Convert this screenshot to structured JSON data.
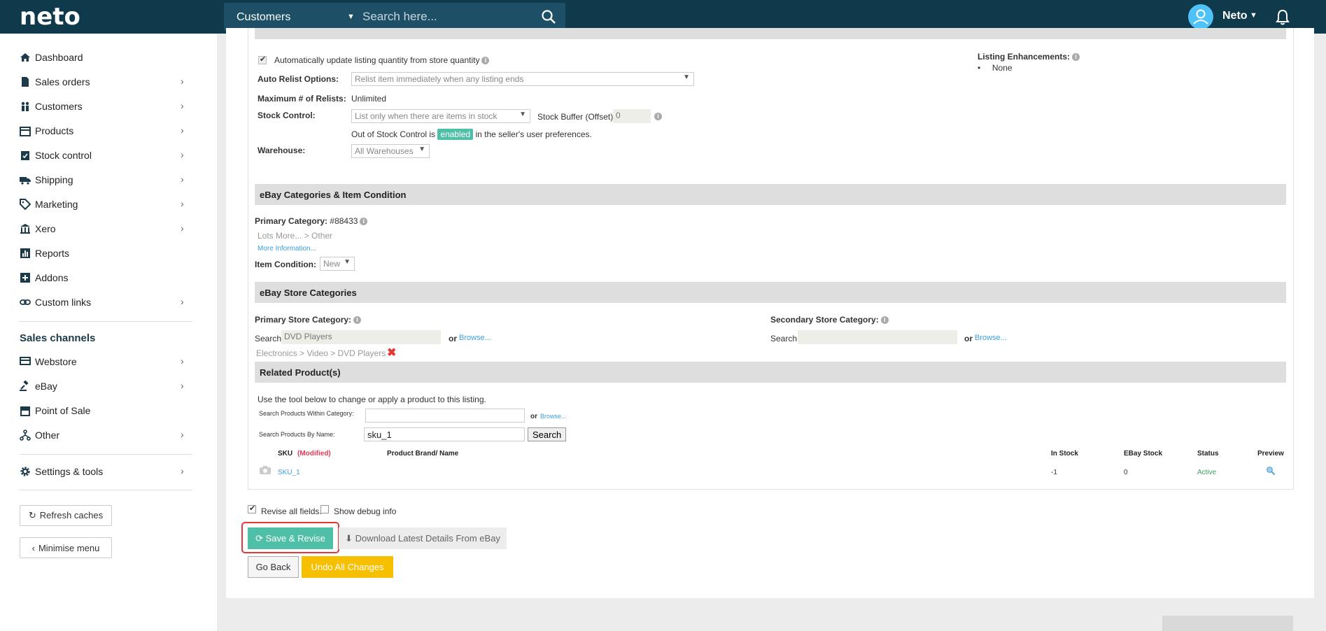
{
  "topbar": {
    "logo": "neto",
    "search_scope": "Customers",
    "search_placeholder": "Search here...",
    "username": "Neto"
  },
  "sidebar": {
    "items": [
      {
        "label": "Dashboard",
        "icon": "home-icon",
        "chevron": false
      },
      {
        "label": "Sales orders",
        "icon": "document-icon",
        "chevron": true
      },
      {
        "label": "Customers",
        "icon": "people-icon",
        "chevron": true
      },
      {
        "label": "Products",
        "icon": "box-icon",
        "chevron": true
      },
      {
        "label": "Stock control",
        "icon": "clipboard-icon",
        "chevron": true
      },
      {
        "label": "Shipping",
        "icon": "truck-icon",
        "chevron": true
      },
      {
        "label": "Marketing",
        "icon": "tag-icon",
        "chevron": true
      },
      {
        "label": "Xero",
        "icon": "bank-icon",
        "chevron": true
      },
      {
        "label": "Reports",
        "icon": "chart-icon",
        "chevron": false
      },
      {
        "label": "Addons",
        "icon": "plus-icon",
        "chevron": false
      },
      {
        "label": "Custom links",
        "icon": "link-icon",
        "chevron": true
      }
    ],
    "channels_heading": "Sales channels",
    "channels": [
      {
        "label": "Webstore",
        "icon": "monitor-icon",
        "chevron": true
      },
      {
        "label": "eBay",
        "icon": "gavel-icon",
        "chevron": true
      },
      {
        "label": "Point of Sale",
        "icon": "store-icon",
        "chevron": false
      },
      {
        "label": "Other",
        "icon": "fork-icon",
        "chevron": true
      }
    ],
    "settings": {
      "label": "Settings & tools",
      "icon": "gear-icon",
      "chevron": true
    },
    "refresh_label": "Refresh caches",
    "minimise_label": "Minimise menu"
  },
  "listing": {
    "auto_update_label": "Automatically update listing quantity from store quantity",
    "enhancements_label": "Listing Enhancements:",
    "enhancements_value": "None",
    "auto_relist_label": "Auto Relist Options:",
    "auto_relist_value": "Relist item immediately when any listing ends",
    "max_relists_label": "Maximum # of Relists:",
    "max_relists_value": "Unlimited",
    "stock_control_label": "Stock Control:",
    "stock_control_value": "List only when there are items in stock",
    "stock_buffer_label": "Stock Buffer (Offset)",
    "stock_buffer_value": "0",
    "oos_prefix": "Out of Stock Control is",
    "oos_badge": "enabled",
    "oos_suffix": "in the seller's user preferences.",
    "warehouse_label": "Warehouse:",
    "warehouse_value": "All Warehouses"
  },
  "categories": {
    "heading": "eBay Categories & Item Condition",
    "primary_label": "Primary Category:",
    "primary_value": "#88433",
    "path": "Lots More... > Other",
    "more_info": "More Information...",
    "condition_label": "Item Condition:",
    "condition_value": "New"
  },
  "store_categories": {
    "heading": "eBay Store Categories",
    "primary_label": "Primary Store Category:",
    "secondary_label": "Secondary Store Category:",
    "search_label": "Search",
    "primary_search_value": "DVD Players",
    "secondary_search_value": "",
    "or_label": "or",
    "browse_link": "Browse...",
    "primary_path": "Electronics > Video > DVD Players"
  },
  "related": {
    "heading": "Related Product(s)",
    "intro": "Use the tool below to change or apply a product to this listing.",
    "within_category_label": "Search Products Within Category:",
    "within_category_value": "",
    "by_name_label": "Search Products By Name:",
    "by_name_value": "sku_1",
    "search_button": "Search",
    "or_label": "or",
    "browse_link": "Browse...",
    "table": {
      "headers": {
        "sku": "SKU",
        "modified": "(Modified)",
        "brand": "Product Brand/ Name",
        "in_stock": "In Stock",
        "ebay_stock": "EBay Stock",
        "status": "Status",
        "preview": "Preview"
      },
      "rows": [
        {
          "sku": "SKU_1",
          "brand": "",
          "in_stock": "-1",
          "ebay_stock": "0",
          "status": "Active"
        }
      ]
    }
  },
  "options": {
    "revise_all_label": "Revise all fields.",
    "revise_all_checked": true,
    "debug_label": "Show debug info",
    "debug_checked": false
  },
  "actions": {
    "save_revise": "Save & Revise",
    "download": "Download Latest Details From eBay",
    "go_back": "Go Back",
    "undo": "Undo All Changes"
  },
  "colors": {
    "topbar": "#0f3a4c",
    "accent_green": "#4fbfa8",
    "undo_yellow": "#f6c000",
    "link_blue": "#3aa0d8",
    "highlight_red": "#e53935"
  }
}
